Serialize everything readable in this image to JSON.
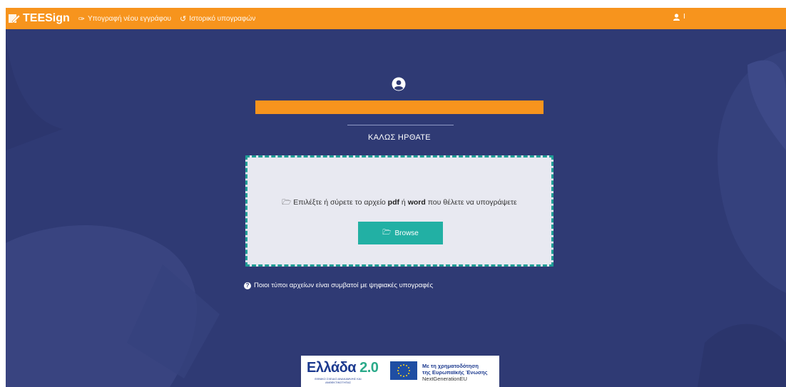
{
  "navbar": {
    "brand": "TEESign",
    "links": [
      {
        "label": "Υπογραφή νέου εγγράφου",
        "icon": "signature-icon"
      },
      {
        "label": "Ιστορικό υπογραφών",
        "icon": "history-icon"
      }
    ],
    "user_label": "I"
  },
  "main": {
    "welcome": "ΚΑΛΩΣ ΗΡΘΑΤΕ",
    "dropzone": {
      "text_prefix": "Επιλέξτε ή σύρετε το αρχείο",
      "pdf": "pdf",
      "or": "ή",
      "word": "word",
      "text_suffix": "που θέλετε να υπογράψετε",
      "browse_label": "Browse"
    },
    "help_text": "Ποιοι τύποι αρχείων είναι συμβατοί με ψηφιακές υπογραφές"
  },
  "footer_logo": {
    "greece_text": "Ελλάδα",
    "greece_version": "2.0",
    "greece_sub": "ΕΘΝΙΚΟ ΣΧΕΔΙΟ ΑΝΑΚΑΜΨΗΣ ΚΑΙ ΑΝΘΕΚΤΙΚΟΤΗΤΑΣ",
    "eu_line1": "Με τη χρηματοδότηση",
    "eu_line2": "της Ευρωπαϊκής Ένωσης",
    "eu_line3": "NextGenerationEU"
  },
  "colors": {
    "navbar": "#f7941d",
    "background": "#2f3a74",
    "accent": "#22b0a4"
  }
}
